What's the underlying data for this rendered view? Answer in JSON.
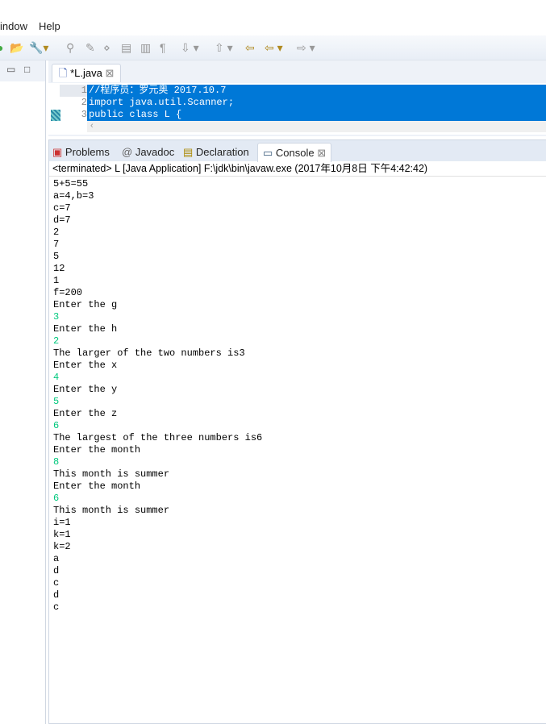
{
  "menu": [
    "indow",
    "Help"
  ],
  "editor": {
    "tab": "*L.java",
    "close": "⊠",
    "line_numbers": [
      "1",
      "2",
      "3"
    ],
    "lines": [
      "//程序员：罗元奥 2017.10.7",
      "import java.util.Scanner;",
      "public class L {"
    ]
  },
  "console_tabs": [
    {
      "label": "Problems"
    },
    {
      "label": "Javadoc"
    },
    {
      "label": "Declaration"
    },
    {
      "label": "Console"
    }
  ],
  "status": "<terminated> L [Java Application] F:\\jdk\\bin\\javaw.exe (2017年10月8日 下午4:42:42)",
  "output": [
    {
      "t": "5+5=55",
      "in": false
    },
    {
      "t": "a=4,b=3",
      "in": false
    },
    {
      "t": "c=7",
      "in": false
    },
    {
      "t": "d=7",
      "in": false
    },
    {
      "t": "2",
      "in": false
    },
    {
      "t": "7",
      "in": false
    },
    {
      "t": "5",
      "in": false
    },
    {
      "t": "12",
      "in": false
    },
    {
      "t": "1",
      "in": false
    },
    {
      "t": "f=200",
      "in": false
    },
    {
      "t": "Enter the g",
      "in": false
    },
    {
      "t": "3",
      "in": true
    },
    {
      "t": "Enter the h",
      "in": false
    },
    {
      "t": "2",
      "in": true
    },
    {
      "t": "The larger of the two numbers is3",
      "in": false
    },
    {
      "t": "Enter the x",
      "in": false
    },
    {
      "t": "4",
      "in": true
    },
    {
      "t": "Enter the y",
      "in": false
    },
    {
      "t": "5",
      "in": true
    },
    {
      "t": "Enter the z",
      "in": false
    },
    {
      "t": "6",
      "in": true
    },
    {
      "t": "The largest of the three numbers is6",
      "in": false
    },
    {
      "t": "Enter the month",
      "in": false
    },
    {
      "t": "8",
      "in": true
    },
    {
      "t": "This month is summer",
      "in": false
    },
    {
      "t": "Enter the month",
      "in": false
    },
    {
      "t": "6",
      "in": true
    },
    {
      "t": "This month is summer",
      "in": false
    },
    {
      "t": "i=1",
      "in": false
    },
    {
      "t": "k=1",
      "in": false
    },
    {
      "t": "k=2",
      "in": false
    },
    {
      "t": "a",
      "in": false
    },
    {
      "t": "d",
      "in": false
    },
    {
      "t": "c",
      "in": false
    },
    {
      "t": "d",
      "in": false
    },
    {
      "t": "c",
      "in": false
    }
  ]
}
